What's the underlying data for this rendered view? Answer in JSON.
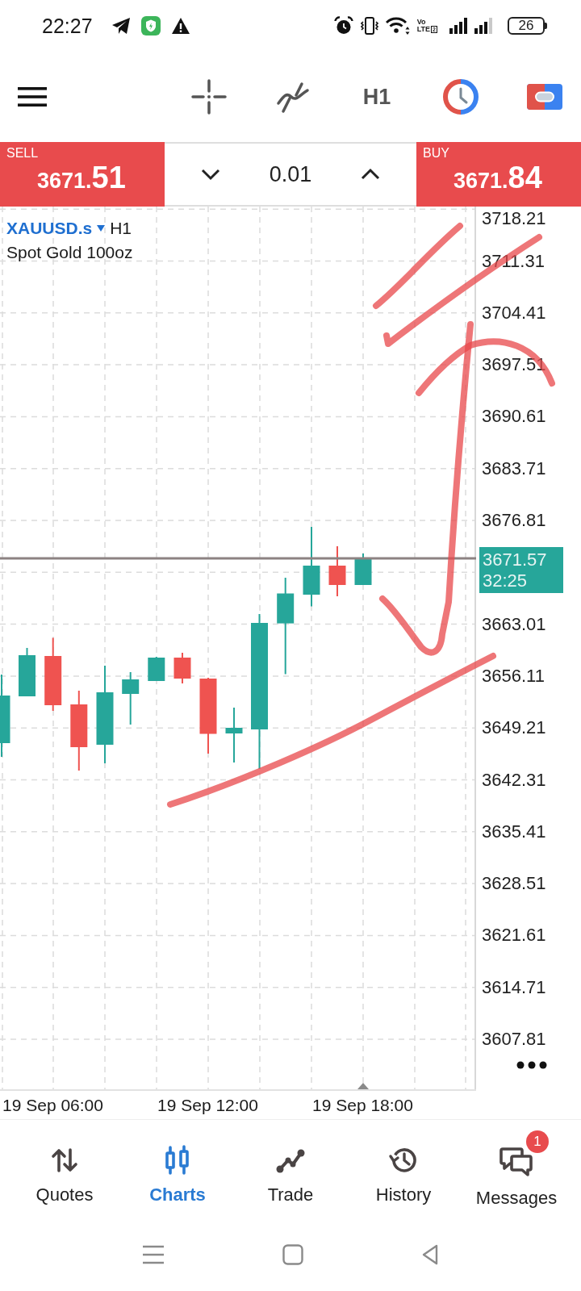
{
  "status_bar": {
    "time": "22:27",
    "volte": {
      "top": "Vo",
      "bottom": "LTE",
      "sim": "2"
    },
    "battery": "26"
  },
  "toolbar": {
    "timeframe": "H1"
  },
  "trade_panel": {
    "sell": {
      "label": "SELL",
      "price": "3671.",
      "pips": "51"
    },
    "volume": "0.01",
    "buy": {
      "label": "BUY",
      "price": "3671.",
      "pips": "84"
    }
  },
  "chart": {
    "symbol": "XAUUSD.s",
    "timeframe": "H1",
    "description": "Spot Gold 100oz",
    "price_axis": [
      {
        "kind": "tick",
        "label": "3718.21"
      },
      {
        "kind": "tick",
        "label": "3711.31"
      },
      {
        "kind": "tick",
        "label": "3704.41"
      },
      {
        "kind": "tick",
        "label": "3697.51"
      },
      {
        "kind": "tick",
        "label": "3690.61"
      },
      {
        "kind": "tick",
        "label": "3683.71"
      },
      {
        "kind": "tick",
        "label": "3676.81"
      },
      {
        "kind": "current",
        "price": "3671.57",
        "countdown": "32:25"
      },
      {
        "kind": "tick",
        "label": "3663.01"
      },
      {
        "kind": "tick",
        "label": "3656.11"
      },
      {
        "kind": "tick",
        "label": "3649.21"
      },
      {
        "kind": "tick",
        "label": "3642.31"
      },
      {
        "kind": "tick",
        "label": "3635.41"
      },
      {
        "kind": "tick",
        "label": "3628.51"
      },
      {
        "kind": "tick",
        "label": "3621.61"
      },
      {
        "kind": "tick",
        "label": "3614.71"
      },
      {
        "kind": "tick",
        "label": "3607.81"
      }
    ],
    "time_axis": [
      "19 Sep 06:00",
      "19 Sep 12:00",
      "19 Sep 18:00"
    ]
  },
  "bottom_nav": [
    {
      "label": "Quotes",
      "selected": false
    },
    {
      "label": "Charts",
      "selected": true
    },
    {
      "label": "Trade",
      "selected": false
    },
    {
      "label": "History",
      "selected": false
    },
    {
      "label": "Messages",
      "selected": false,
      "badge": "1"
    }
  ]
}
